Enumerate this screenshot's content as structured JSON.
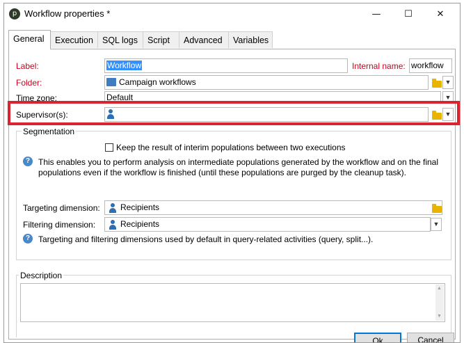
{
  "window": {
    "title": "Workflow properties *",
    "app_icon_glyph": "p",
    "controls": {
      "minimize": "—",
      "maximize": "☐",
      "close": "✕"
    }
  },
  "tabs": [
    {
      "label": "General",
      "active": true
    },
    {
      "label": "Execution",
      "active": false
    },
    {
      "label": "SQL logs",
      "active": false
    },
    {
      "label": "Script",
      "active": false
    },
    {
      "label": "Advanced",
      "active": false
    },
    {
      "label": "Variables",
      "active": false
    }
  ],
  "general": {
    "label_caption": "Label:",
    "label_value": "Workflow",
    "internal_name_caption": "Internal name:",
    "internal_name_value": "workflow",
    "folder_caption": "Folder:",
    "folder_value": "Campaign workflows",
    "timezone_caption": "Time zone:",
    "timezone_value": "Default",
    "supervisors_caption": "Supervisor(s):",
    "supervisors_value": ""
  },
  "segmentation": {
    "legend": "Segmentation",
    "keep_populations_label": "Keep the result of interim populations between two executions",
    "keep_populations_checked": false,
    "help_text_line1": "This enables you to perform analysis on intermediate populations generated by the workflow and on the final",
    "help_text_line2": "populations even if the workflow is finished (until these populations are purged by the cleanup task).",
    "targeting_caption": "Targeting dimension:",
    "targeting_value": "Recipients",
    "filtering_caption": "Filtering dimension:",
    "filtering_value": "Recipients",
    "dimensions_help": "Targeting and filtering dimensions used by default in query-related activities (query, split...)."
  },
  "description": {
    "legend": "Description",
    "value": ""
  },
  "buttons": {
    "ok": "Ok",
    "cancel": "Cancel"
  },
  "colors": {
    "required_label": "#c8001c",
    "highlight_border": "#d9262e",
    "selection": "#3390ff",
    "folder": "#e9b400"
  }
}
